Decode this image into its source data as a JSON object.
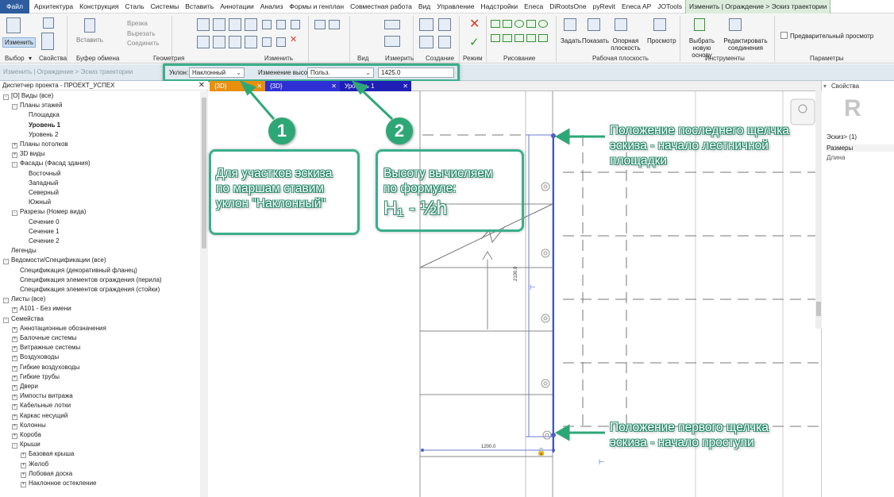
{
  "menu": {
    "tabs": [
      "Файл",
      "Архитектура",
      "Конструкция",
      "Сталь",
      "Системы",
      "Вставить",
      "Аннотации",
      "Анализ",
      "Формы и генплан",
      "Совместная работа",
      "Вид",
      "Управление",
      "Надстройки",
      "Eneca",
      "DiRootsOne",
      "pyRevit",
      "Eneca AP",
      "JOTools",
      "Изменить | Ограждение > Эскиз траектории"
    ]
  },
  "ribbon": {
    "modify_label": "Изменить",
    "paste_label": "Вставить",
    "cut_label": "Врезка",
    "cut_clip_label": "Вырезать",
    "join_label": "Соединить",
    "bottom": {
      "select": "Выбор",
      "properties": "Свойства",
      "clipboard": "Буфер обмена",
      "geometry": "Геометрия",
      "modify": "Изменить",
      "view": "Вид",
      "measure": "Измерить",
      "create": "Создание",
      "mode": "Режим",
      "draw": "Рисование",
      "workplane": "Рабочая плоскость",
      "tools": "Инструменты",
      "params": "Параметры"
    },
    "set_label": "Задать",
    "show_label": "Показать",
    "ref_plane_label": "Опорная плоскость",
    "viewer_label": "Просмотр",
    "pick_host_label": "Выбрать новую основу",
    "edit_joins_label": "Редактировать соединения",
    "preview_label": "Предварительный просмотр"
  },
  "options": {
    "breadcrumb": "Изменить | Ограждение > Эскиз траектории",
    "slope_label": "Уклон:",
    "slope_value": "Наклонный",
    "height_change_label": "Изменение высоты:",
    "height_change_value": "Польз.",
    "height_input": "1425.0"
  },
  "browser": {
    "title": "Диспетчер проекта - ПРОЕКТ_УСПЕХ",
    "items": [
      {
        "label": "[O] Виды (все)",
        "lvl": 0,
        "tog": "-"
      },
      {
        "label": "Планы этажей",
        "lvl": 1,
        "tog": "-"
      },
      {
        "label": "Площадка",
        "lvl": 2,
        "tog": ""
      },
      {
        "label": "Уровень 1",
        "lvl": 2,
        "tog": "",
        "bold": true
      },
      {
        "label": "Уровень 2",
        "lvl": 2,
        "tog": ""
      },
      {
        "label": "Планы потолков",
        "lvl": 1,
        "tog": "+"
      },
      {
        "label": "3D виды",
        "lvl": 1,
        "tog": "+"
      },
      {
        "label": "Фасады (Фасад здания)",
        "lvl": 1,
        "tog": "-"
      },
      {
        "label": "Восточный",
        "lvl": 2,
        "tog": ""
      },
      {
        "label": "Западный",
        "lvl": 2,
        "tog": ""
      },
      {
        "label": "Северный",
        "lvl": 2,
        "tog": ""
      },
      {
        "label": "Южный",
        "lvl": 2,
        "tog": ""
      },
      {
        "label": "Разрезы (Номер вида)",
        "lvl": 1,
        "tog": "-"
      },
      {
        "label": "Сечение 0",
        "lvl": 2,
        "tog": ""
      },
      {
        "label": "Сечение 1",
        "lvl": 2,
        "tog": ""
      },
      {
        "label": "Сечение 2",
        "lvl": 2,
        "tog": ""
      },
      {
        "label": "Легенды",
        "lvl": 0,
        "tog": ""
      },
      {
        "label": "Ведомости/Спецификации (все)",
        "lvl": 0,
        "tog": "-"
      },
      {
        "label": "Спецификация (декоративный фланец)",
        "lvl": 1,
        "tog": ""
      },
      {
        "label": "Спецификация элементов ограждения (перила)",
        "lvl": 1,
        "tog": ""
      },
      {
        "label": "Спецификация элементов ограждения (стойки)",
        "lvl": 1,
        "tog": ""
      },
      {
        "label": "Листы (все)",
        "lvl": 0,
        "tog": "-"
      },
      {
        "label": "A101 - Без имени",
        "lvl": 1,
        "tog": "+"
      },
      {
        "label": "Семейства",
        "lvl": 0,
        "tog": "-"
      },
      {
        "label": "Аннотационные обозначения",
        "lvl": 1,
        "tog": "+"
      },
      {
        "label": "Балочные системы",
        "lvl": 1,
        "tog": "+"
      },
      {
        "label": "Витражные системы",
        "lvl": 1,
        "tog": "+"
      },
      {
        "label": "Воздуховоды",
        "lvl": 1,
        "tog": "+"
      },
      {
        "label": "Гибкие воздуховоды",
        "lvl": 1,
        "tog": "+"
      },
      {
        "label": "Гибкие трубы",
        "lvl": 1,
        "tog": "+"
      },
      {
        "label": "Двери",
        "lvl": 1,
        "tog": "+"
      },
      {
        "label": "Импосты витража",
        "lvl": 1,
        "tog": "+"
      },
      {
        "label": "Кабельные лотки",
        "lvl": 1,
        "tog": "+"
      },
      {
        "label": "Каркас несущий",
        "lvl": 1,
        "tog": "+"
      },
      {
        "label": "Колонны",
        "lvl": 1,
        "tog": "+"
      },
      {
        "label": "Короба",
        "lvl": 1,
        "tog": "+"
      },
      {
        "label": "Крыши",
        "lvl": 1,
        "tog": "-"
      },
      {
        "label": "Базовая крыша",
        "lvl": 2,
        "tog": "+"
      },
      {
        "label": "Желоб",
        "lvl": 2,
        "tog": "+"
      },
      {
        "label": "Лобовая доска",
        "lvl": 2,
        "tog": "+"
      },
      {
        "label": "Наклонное остекление",
        "lvl": 2,
        "tog": "+"
      }
    ]
  },
  "view_tabs": [
    {
      "label": "{3D}",
      "color": "#e8900c"
    },
    {
      "label": "{3D}",
      "color": "#2f2fd6"
    },
    {
      "label": "Уровень 1",
      "color": "#1f1fb8"
    }
  ],
  "canvas": {
    "dim_vertical": "2100.0",
    "dim_horizontal": "1200.0"
  },
  "properties": {
    "title": "Свойства",
    "type_label": "Эскиз> (1)",
    "section": "Размеры",
    "row": "Длина"
  },
  "callouts": {
    "c1_text": [
      "Для участков эскиза",
      "по маршам ставим",
      "уклон \"Наклонный\""
    ],
    "c2_text": [
      "Высоту вычисляем",
      "по формуле:"
    ],
    "c2_formula": "H₁ - ½h",
    "badge1": "1",
    "badge2": "2",
    "last_click": [
      "Положение последнего  щелчка",
      "эскиза - начало лестничной",
      "площадки"
    ],
    "first_click": [
      "Положение первого щелчка",
      "эскиза - начало проступи"
    ]
  },
  "colors": {
    "accent": "#3cae8c",
    "badge": "#2ea776",
    "file_tab": "#2d5d9f"
  }
}
